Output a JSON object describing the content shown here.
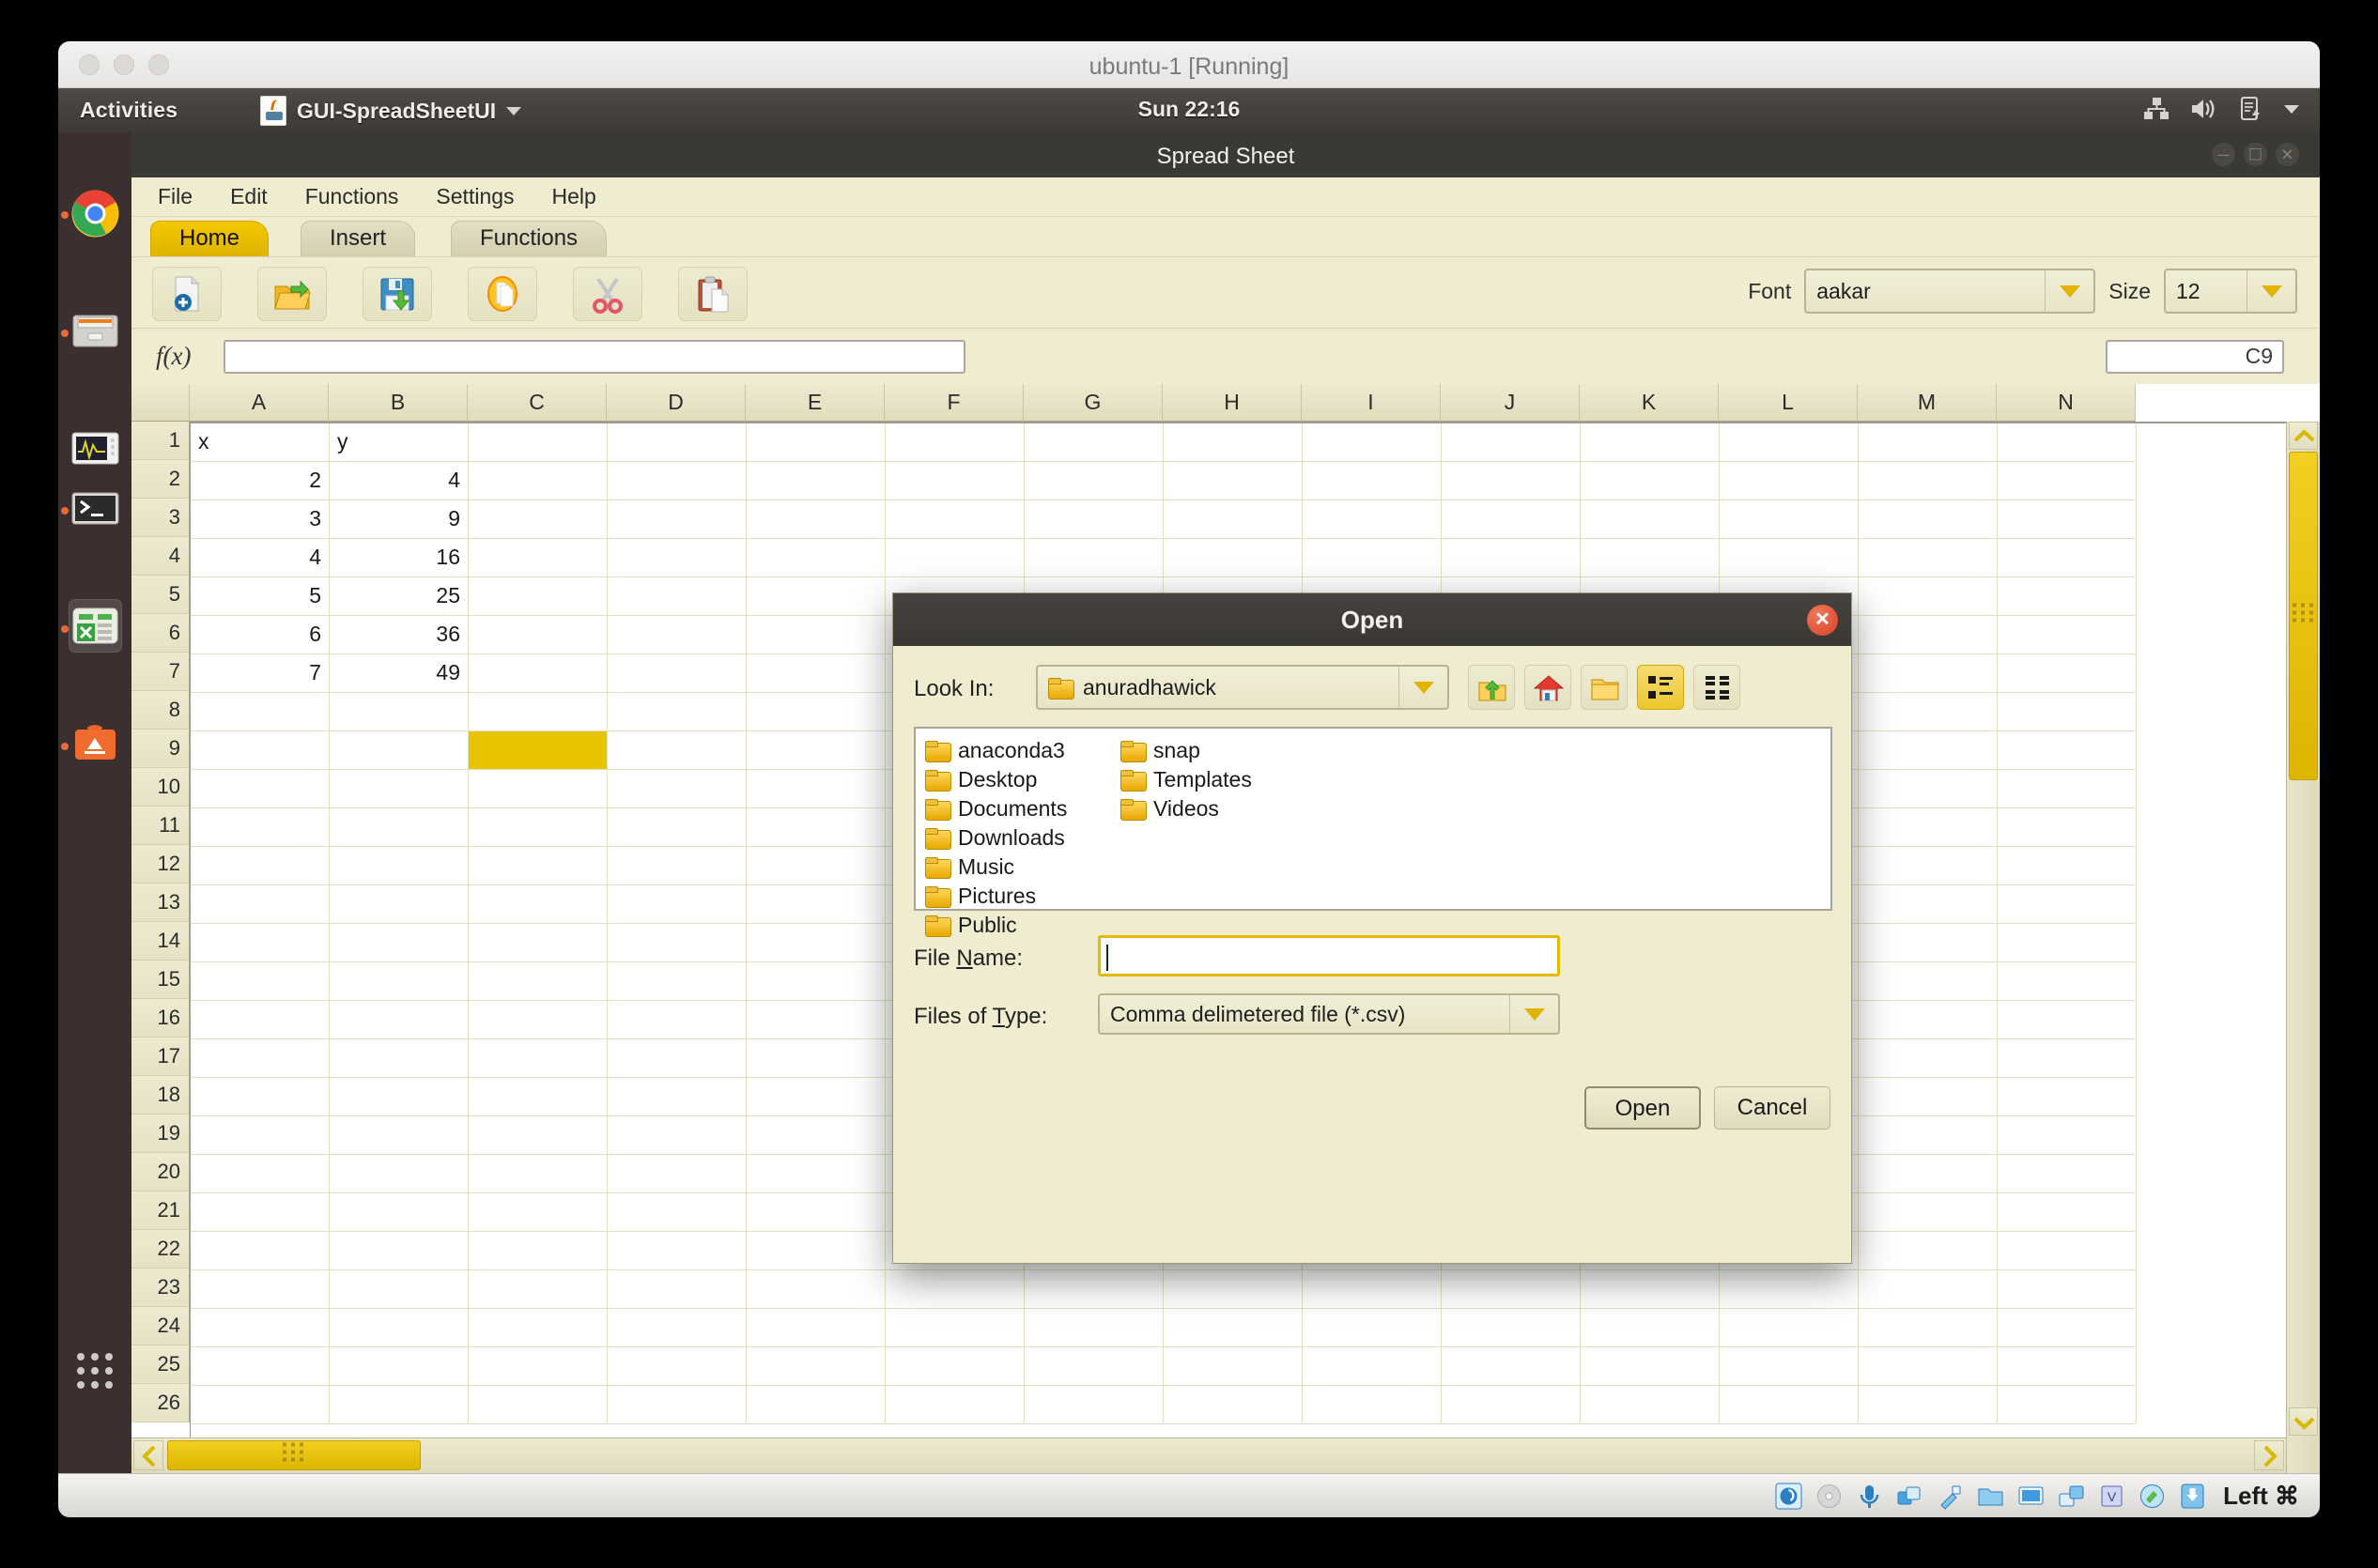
{
  "vm": {
    "title": "ubuntu-1 [Running]"
  },
  "ubuntu_panel": {
    "activities": "Activities",
    "app_menu": "GUI-SpreadSheetUI",
    "clock": "Sun 22:16",
    "indicators": [
      "network-icon",
      "volume-icon",
      "battery-icon",
      "system-menu-caret-icon"
    ]
  },
  "launcher": {
    "items": [
      {
        "name": "chrome",
        "running": true
      },
      {
        "name": "files",
        "running": true
      },
      {
        "name": "system-monitor",
        "running": false
      },
      {
        "name": "terminal",
        "running": true
      },
      {
        "name": "spreadsheet",
        "running": true,
        "active": true
      },
      {
        "name": "ubuntu-software",
        "running": true
      },
      {
        "name": "show-applications",
        "running": false
      }
    ]
  },
  "app": {
    "title": "Spread Sheet",
    "menus": [
      "File",
      "Edit",
      "Functions",
      "Settings",
      "Help"
    ],
    "tabs": [
      {
        "label": "Home",
        "active": true
      },
      {
        "label": "Insert",
        "active": false
      },
      {
        "label": "Functions",
        "active": false
      }
    ],
    "toolbar": [
      {
        "name": "new-file-button",
        "icon": "new-document-icon"
      },
      {
        "name": "open-file-button",
        "icon": "open-folder-icon"
      },
      {
        "name": "save-file-button",
        "icon": "floppy-save-icon"
      },
      {
        "name": "copy-button",
        "icon": "copy-icon"
      },
      {
        "name": "cut-button",
        "icon": "scissors-icon"
      },
      {
        "name": "paste-button",
        "icon": "clipboard-paste-icon"
      }
    ],
    "font": {
      "label": "Font",
      "value": "aakar"
    },
    "size": {
      "label": "Size",
      "value": "12"
    },
    "formula": {
      "fx_label": "f(x)",
      "value": "",
      "cell_ref": "C9"
    }
  },
  "grid": {
    "columns": [
      "A",
      "B",
      "C",
      "D",
      "E",
      "F",
      "G",
      "H",
      "I",
      "J",
      "K",
      "L",
      "M",
      "N"
    ],
    "rows": [
      "1",
      "2",
      "3",
      "4",
      "5",
      "6",
      "7",
      "8",
      "9",
      "10",
      "11",
      "12",
      "13",
      "14",
      "15",
      "16",
      "17",
      "18",
      "19",
      "20",
      "21",
      "22",
      "23",
      "24",
      "25",
      "26"
    ],
    "selected_cell": "C9",
    "cell_data": {
      "A1": "x",
      "B1": "y",
      "A2": "2",
      "B2": "4",
      "A3": "3",
      "B3": "9",
      "A4": "4",
      "B4": "16",
      "A5": "5",
      "B5": "25",
      "A6": "6",
      "B6": "36",
      "A7": "7",
      "B7": "49"
    }
  },
  "dialog": {
    "title": "Open",
    "close_label": "✕",
    "lookin": {
      "label": "Look In:",
      "value": "anuradhawick"
    },
    "tools": [
      {
        "name": "go-up-button",
        "icon": "up-folder-icon",
        "selected": false
      },
      {
        "name": "home-button",
        "icon": "home-icon",
        "selected": false
      },
      {
        "name": "new-folder-button",
        "icon": "new-folder-icon",
        "selected": false
      },
      {
        "name": "list-view-button",
        "icon": "list-view-icon",
        "selected": true
      },
      {
        "name": "details-view-button",
        "icon": "details-view-icon",
        "selected": false
      }
    ],
    "files_col1": [
      "anaconda3",
      "Desktop",
      "Documents",
      "Downloads",
      "Music",
      "Pictures",
      "Public"
    ],
    "files_col2": [
      "snap",
      "Templates",
      "Videos"
    ],
    "filename": {
      "label_pre": "File ",
      "label_key": "N",
      "label_post": "ame:",
      "value": ""
    },
    "filetype": {
      "label_pre": "Files of ",
      "label_key": "T",
      "label_post": "ype:",
      "value": "Comma delimetered file (*.csv)"
    },
    "buttons": {
      "open": "Open",
      "cancel": "Cancel"
    }
  },
  "vbox_status": {
    "icons": [
      "hard-disk-icon",
      "optical-disk-icon",
      "audio-icon",
      "network-icon",
      "usb-icon",
      "shared-folders-icon",
      "display-icon",
      "recording-icon",
      "cpu-icon",
      "mouse-integration-icon",
      "keyboard-capture-icon"
    ],
    "host_key": "Left ⌘"
  }
}
